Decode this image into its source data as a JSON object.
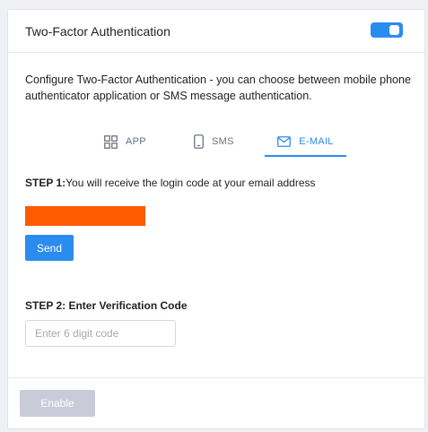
{
  "header": {
    "title": "Two-Factor Authentication",
    "toggle": {
      "state": "on",
      "color": "#2b8cf0"
    }
  },
  "description": "Configure Two-Factor Authentication - you can choose between mobile phone authenticator application or SMS message authentication.",
  "tabs": [
    {
      "label": "APP",
      "icon": "grid-icon",
      "active": false
    },
    {
      "label": "SMS",
      "icon": "phone-icon",
      "active": false
    },
    {
      "label": "E-MAIL",
      "icon": "mail-icon",
      "active": true
    }
  ],
  "step1": {
    "prefix": "STEP 1:",
    "text": "You will receive the login code at your email address"
  },
  "send_label": "Send",
  "step2": {
    "label": "STEP 2: Enter Verification Code"
  },
  "code_input": {
    "value": "",
    "placeholder": "Enter 6 digit code"
  },
  "enable_label": "Enable",
  "colors": {
    "accent": "#2b8cf0",
    "redaction": "#ff5a00",
    "disabled_button": "#c9ccd8"
  }
}
